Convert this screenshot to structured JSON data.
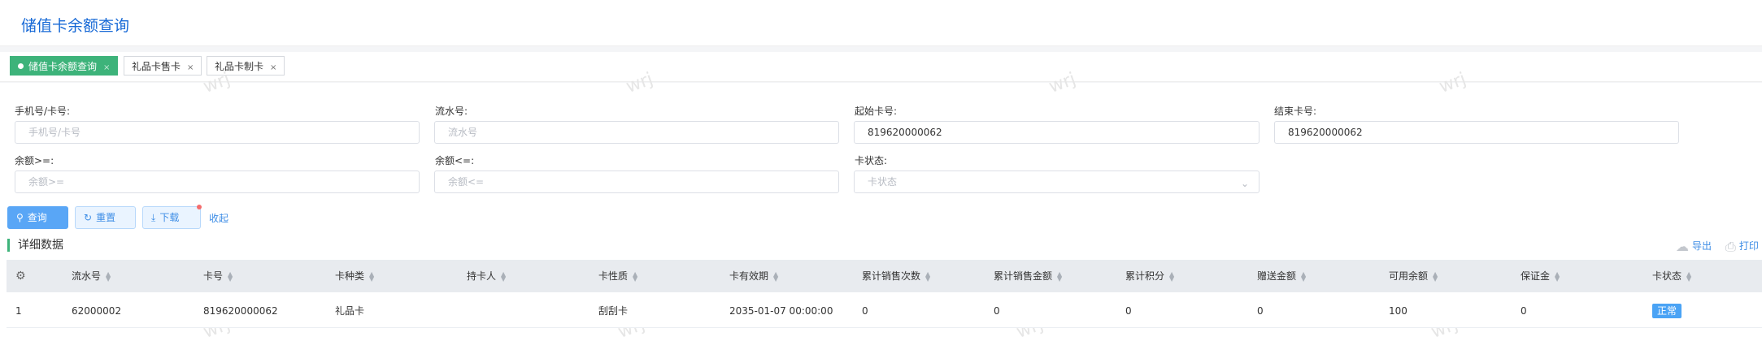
{
  "page": {
    "title": "储值卡余额查询"
  },
  "tabs": [
    {
      "label": "储值卡余额查询",
      "active": true,
      "close": "×"
    },
    {
      "label": "礼品卡售卡",
      "active": false,
      "close": "×"
    },
    {
      "label": "礼品卡制卡",
      "active": false,
      "close": "×"
    }
  ],
  "filters": {
    "phone": {
      "label": "手机号/卡号:",
      "placeholder": "手机号/卡号",
      "value": ""
    },
    "serial": {
      "label": "流水号:",
      "placeholder": "流水号",
      "value": ""
    },
    "start_card": {
      "label": "起始卡号:",
      "value": "819620000062"
    },
    "end_card": {
      "label": "结束卡号:",
      "value": "819620000062"
    },
    "balance_min": {
      "label": "余额>=:",
      "placeholder": "余额>=",
      "value": ""
    },
    "balance_max": {
      "label": "余额<=:",
      "placeholder": "余额<=",
      "value": ""
    },
    "card_status": {
      "label": "卡状态:",
      "placeholder": "卡状态",
      "value": ""
    }
  },
  "actions": {
    "query": "查询",
    "reset": "重置",
    "download": "下载",
    "collapse": "收起"
  },
  "section": {
    "title": "详细数据",
    "export": "导出",
    "print": "打印"
  },
  "table": {
    "columns": [
      "流水号",
      "卡号",
      "卡种类",
      "持卡人",
      "卡性质",
      "卡有效期",
      "累计销售次数",
      "累计销售金额",
      "累计积分",
      "赠送金额",
      "可用余额",
      "保证金",
      "卡状态"
    ],
    "rows": [
      {
        "index": "1",
        "serial": "62000002",
        "card_no": "819620000062",
        "card_type": "礼品卡",
        "holder": "",
        "nature": "刮刮卡",
        "expiry": "2035-01-07 00:00:00",
        "sales_count": "0",
        "sales_amount": "0",
        "points": "0",
        "gift_amount": "0",
        "balance": "100",
        "deposit": "0",
        "status": "正常"
      }
    ]
  },
  "watermark": "wrj",
  "colors": {
    "brand": "#1769d6",
    "active_tab": "#3db37a",
    "primary_button": "#59a6f6",
    "status_tag": "#4aa3f5"
  }
}
